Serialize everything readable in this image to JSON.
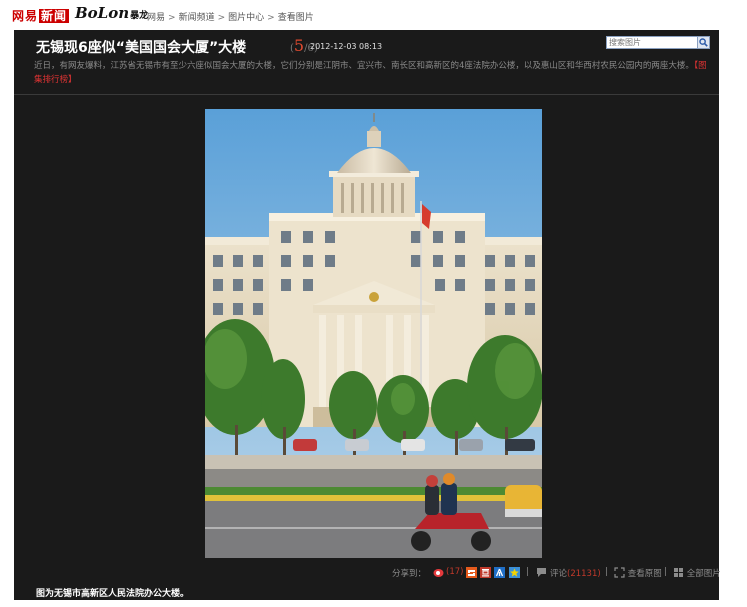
{
  "header": {
    "logo_netease": "网易",
    "logo_news": "新闻",
    "logo_bolon": "BoLon",
    "logo_bolon_sub": "暴龙",
    "breadcrumb": [
      "网易",
      "新闻频道",
      "图片中心",
      "查看图片"
    ],
    "breadcrumb_sep": ">"
  },
  "gallery": {
    "title": "无锡现6座似“美国国会大厦”大楼",
    "counter_current": "5",
    "counter_total": "/6)",
    "counter_open": "(",
    "date": "2012-12-03 08:13",
    "search_placeholder": "搜索图片",
    "description": "近日，有网友爆料，江苏省无锡市有至少六座似国会大厦的大楼，它们分别是江阴市、宜兴市、南长区和高新区的4座法院办公楼，以及惠山区和华西村农民公园内的两座大楼。",
    "rank_link": "【图集排行榜】",
    "caption": "图为无锡市高新区人民法院办公大楼。"
  },
  "sharebar": {
    "share_label": "分享到：",
    "weibo_count": "17",
    "comment_label": "评论",
    "comment_count": "(21131)",
    "view_original": "查看原图",
    "all_pictures": "全部图片",
    "separator": "|"
  },
  "colors": {
    "panel_bg": "#1a1a1a",
    "accent_red": "#e04a2f",
    "brand_red": "#cc0000",
    "muted_text": "#8a8a8a"
  }
}
